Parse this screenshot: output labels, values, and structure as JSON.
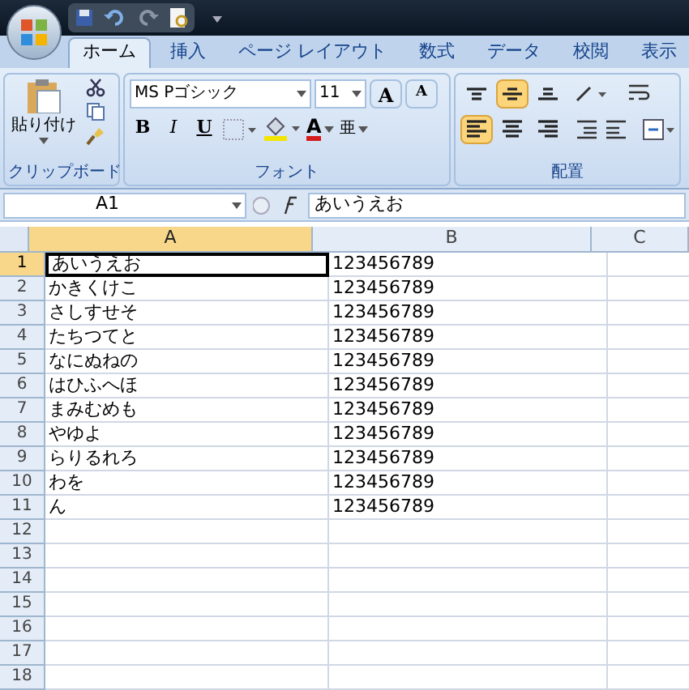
{
  "tabs": [
    {
      "label": "ホーム",
      "selected": true
    },
    {
      "label": "挿入",
      "selected": false
    },
    {
      "label": "ページ レイアウト",
      "selected": false
    },
    {
      "label": "数式",
      "selected": false
    },
    {
      "label": "データ",
      "selected": false
    },
    {
      "label": "校閲",
      "selected": false
    },
    {
      "label": "表示",
      "selected": false
    }
  ],
  "clipboard": {
    "paste_label": "貼り付け",
    "group_label": "クリップボード"
  },
  "font": {
    "name": "MS Pゴシック",
    "size": "11",
    "grow": "A",
    "shrink": "A",
    "bold": "B",
    "italic": "I",
    "underline": "U",
    "font_color": "A",
    "phonetic": "亜",
    "group_label": "フォント"
  },
  "alignment": {
    "group_label": "配置",
    "vertical": [
      {
        "kind": "top",
        "selected": false
      },
      {
        "kind": "middle",
        "selected": true
      },
      {
        "kind": "bottom",
        "selected": false
      }
    ],
    "horizontal": [
      {
        "kind": "left",
        "selected": true
      },
      {
        "kind": "center",
        "selected": false
      },
      {
        "kind": "right",
        "selected": false
      }
    ]
  },
  "formula_bar": {
    "name_box": "A1",
    "formula": "あいうえお"
  },
  "sheet": {
    "columns": [
      {
        "label": "A",
        "selected": true
      },
      {
        "label": "B",
        "selected": false
      },
      {
        "label": "C",
        "selected": false
      }
    ],
    "rows": [
      {
        "number": "1",
        "selected": true,
        "cells": [
          "あいうえお",
          "123456789"
        ]
      },
      {
        "number": "2",
        "selected": false,
        "cells": [
          "かきくけこ",
          "123456789"
        ]
      },
      {
        "number": "3",
        "selected": false,
        "cells": [
          "さしすせそ",
          "123456789"
        ]
      },
      {
        "number": "4",
        "selected": false,
        "cells": [
          "たちつてと",
          "123456789"
        ]
      },
      {
        "number": "5",
        "selected": false,
        "cells": [
          "なにぬねの",
          "123456789"
        ]
      },
      {
        "number": "6",
        "selected": false,
        "cells": [
          "はひふへほ",
          "123456789"
        ]
      },
      {
        "number": "7",
        "selected": false,
        "cells": [
          "まみむめも",
          "123456789"
        ]
      },
      {
        "number": "8",
        "selected": false,
        "cells": [
          "やゆよ",
          "123456789"
        ]
      },
      {
        "number": "9",
        "selected": false,
        "cells": [
          "らりるれろ",
          "123456789"
        ]
      },
      {
        "number": "10",
        "selected": false,
        "cells": [
          "わを",
          "123456789"
        ]
      },
      {
        "number": "11",
        "selected": false,
        "cells": [
          "ん",
          "123456789"
        ]
      },
      {
        "number": "12",
        "selected": false,
        "cells": []
      },
      {
        "number": "13",
        "selected": false,
        "cells": []
      },
      {
        "number": "14",
        "selected": false,
        "cells": []
      },
      {
        "number": "15",
        "selected": false,
        "cells": []
      },
      {
        "number": "16",
        "selected": false,
        "cells": []
      },
      {
        "number": "17",
        "selected": false,
        "cells": []
      },
      {
        "number": "18",
        "selected": false,
        "cells": []
      }
    ]
  }
}
